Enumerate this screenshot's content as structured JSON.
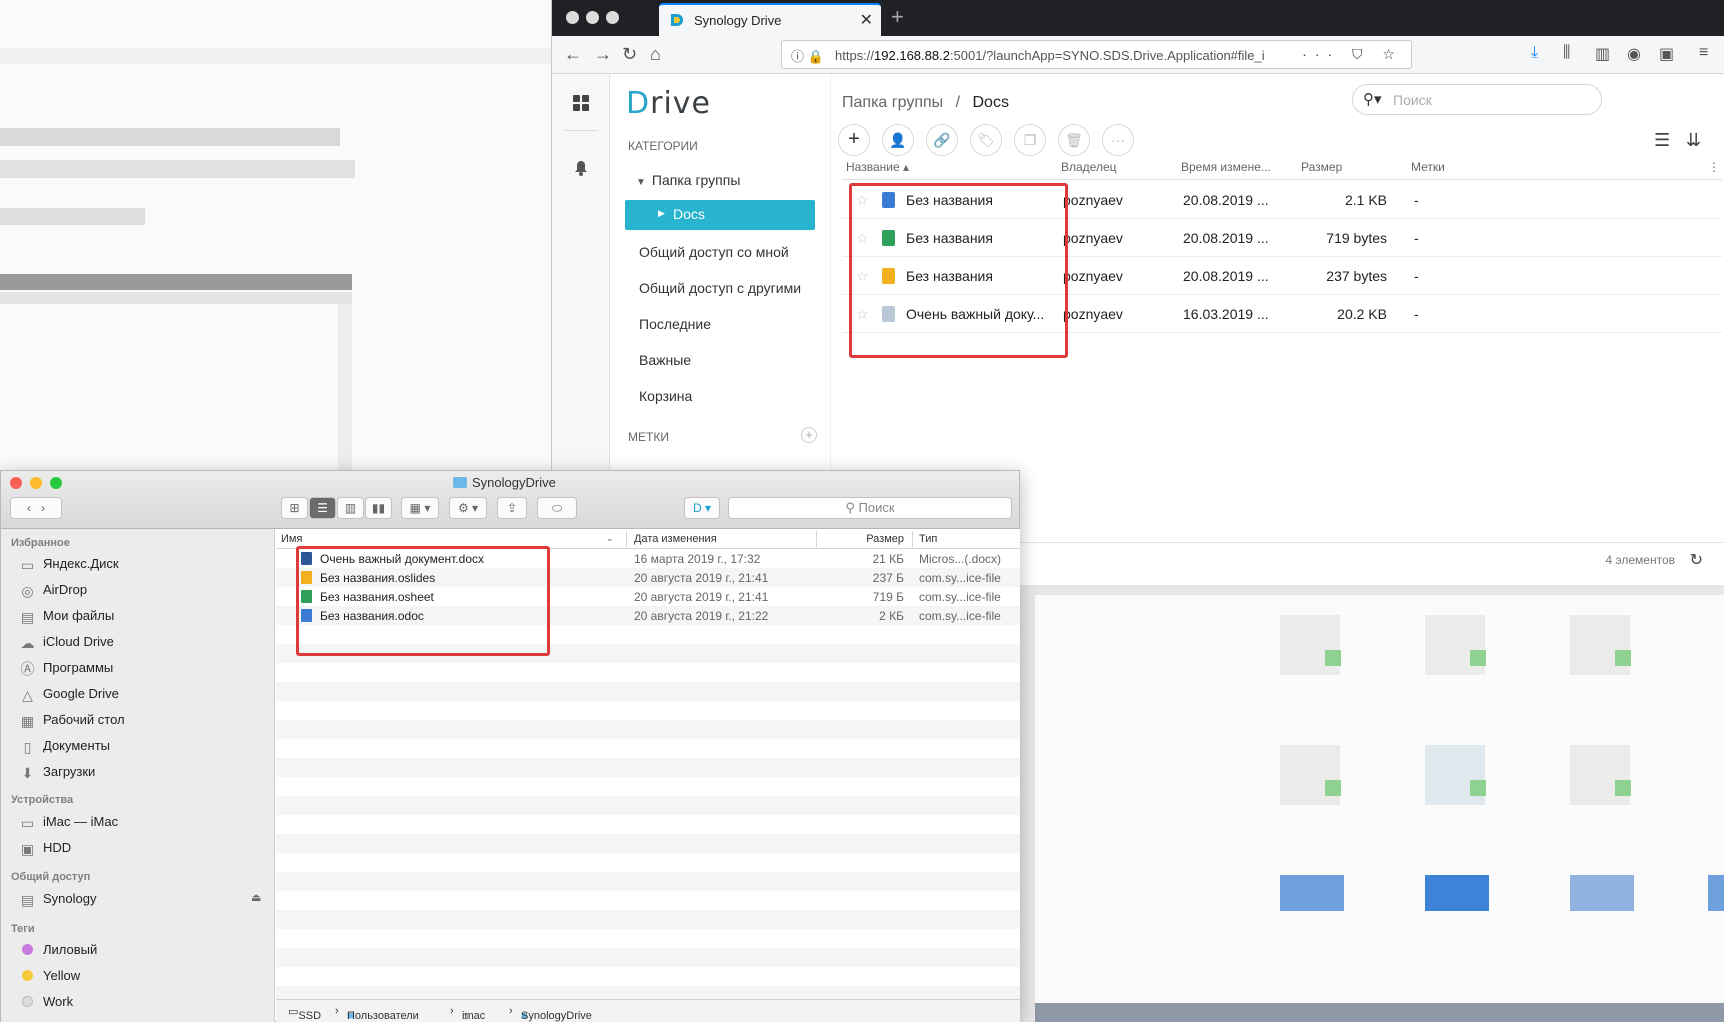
{
  "browser": {
    "tab_title": "Synology Drive",
    "new_tab": "+",
    "url_host": "192.168.88.2",
    "url_prefix": "https://",
    "url_rest": ":5001/?launchApp=SYNO.SDS.Drive.Application#file_i",
    "url_tools": "··· ⛉ ☆"
  },
  "drive": {
    "logo_first": "D",
    "logo_rest": "rive",
    "categories_label": "КАТЕГОРИИ",
    "group_folder": "Папка группы",
    "docs": "Docs",
    "nav": [
      "Общий доступ со мной",
      "Общий доступ с другими",
      "Последние",
      "Важные",
      "Корзина"
    ],
    "tags_label": "МЕТКИ",
    "breadcrumb_root": "Папка группы",
    "breadcrumb_sep": "/",
    "breadcrumb_current": "Docs",
    "search_placeholder": "Поиск",
    "columns": {
      "name": "Название",
      "owner": "Владелец",
      "modified": "Время измене...",
      "size": "Размер",
      "tags": "Метки"
    },
    "files": [
      {
        "name": "Без названия",
        "owner": "poznyaev",
        "modified": "20.08.2019 ...",
        "size": "2.1 KB",
        "tags": "-",
        "color": "#3a7bd5"
      },
      {
        "name": "Без названия",
        "owner": "poznyaev",
        "modified": "20.08.2019 ...",
        "size": "719 bytes",
        "tags": "-",
        "color": "#2ea05a"
      },
      {
        "name": "Без названия",
        "owner": "poznyaev",
        "modified": "20.08.2019 ...",
        "size": "237 bytes",
        "tags": "-",
        "color": "#f2b01e"
      },
      {
        "name": "Очень важный доку...",
        "owner": "poznyaev",
        "modified": "16.03.2019 ...",
        "size": "20.2 KB",
        "tags": "-",
        "color": "#b9c7d6"
      }
    ],
    "item_count": "4 элементов"
  },
  "finder": {
    "title": "SynologyDrive",
    "search_placeholder": "Поиск",
    "sections": {
      "favorites": "Избранное",
      "devices": "Устройства",
      "shared": "Общий доступ",
      "tags": "Теги"
    },
    "favorites": [
      "Яндекс.Диск",
      "AirDrop",
      "Мои файлы",
      "iCloud Drive",
      "Программы",
      "Google Drive",
      "Рабочий стол",
      "Документы",
      "Загрузки"
    ],
    "devices": [
      "iMac — iMac",
      "HDD"
    ],
    "shared": [
      "Synology"
    ],
    "tags": [
      {
        "name": "Лиловый",
        "color": "#c77be0"
      },
      {
        "name": "Yellow",
        "color": "#f5c93a"
      },
      {
        "name": "Work",
        "color": "#dcdcdc"
      }
    ],
    "columns": {
      "name": "Имя",
      "date": "Дата изменения",
      "size": "Размер",
      "type": "Тип"
    },
    "files": [
      {
        "name": "Очень важный документ.docx",
        "date": "16 марта 2019 г., 17:32",
        "size": "21 КБ",
        "type": "Micros...(.docx)",
        "color": "#2b5797"
      },
      {
        "name": "Без названия.oslides",
        "date": "20 августа 2019 г., 21:41",
        "size": "237 Б",
        "type": "com.sy...ice-file",
        "color": "#f2b01e"
      },
      {
        "name": "Без названия.osheet",
        "date": "20 августа 2019 г., 21:41",
        "size": "719 Б",
        "type": "com.sy...ice-file",
        "color": "#2ea05a"
      },
      {
        "name": "Без названия.odoc",
        "date": "20 августа 2019 г., 21:22",
        "size": "2 КБ",
        "type": "com.sy...ice-file",
        "color": "#3a7bd5"
      }
    ],
    "path": [
      "SSD",
      "Пользователи",
      "imac",
      "SynologyDrive"
    ],
    "path_sep": "›"
  }
}
